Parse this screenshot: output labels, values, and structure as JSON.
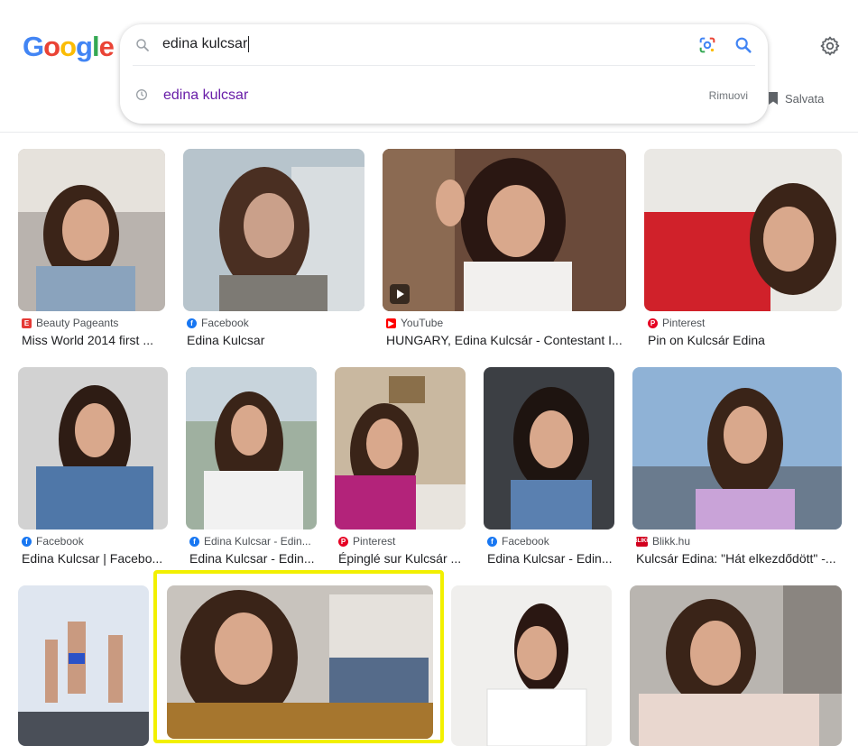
{
  "header": {
    "logo_letters": [
      "G",
      "o",
      "o",
      "g",
      "l",
      "e"
    ],
    "logo_colors": [
      "#4285f4",
      "#ea4335",
      "#fbbc05",
      "#4285f4",
      "#34a853",
      "#ea4335"
    ],
    "settings_icon": "gear-icon"
  },
  "search": {
    "query": "edina kulcsar",
    "suggestion": "edina kulcsar",
    "remove_label": "Rimuovi"
  },
  "saved": {
    "label": "Salvata",
    "icon": "bookmark-icon"
  },
  "results": [
    {
      "source": "Beauty Pageants",
      "title": "Miss World 2014 first ...",
      "icon": "E",
      "fav": "bp"
    },
    {
      "source": "Facebook",
      "title": "Edina Kulcsar",
      "icon": "f",
      "fav": "fb"
    },
    {
      "source": "YouTube",
      "title": "HUNGARY, Edina Kulcsár - Contestant I...",
      "icon": "▶",
      "fav": "yt"
    },
    {
      "source": "Pinterest",
      "title": "Pin on Kulcsár Edina",
      "icon": "P",
      "fav": "pin"
    },
    {
      "source": "Facebook",
      "title": "Edina Kulcsar | Facebo...",
      "icon": "f",
      "fav": "fb"
    },
    {
      "source": "Edina Kulcsar - Edin...",
      "title": "Edina Kulcsar - Edin...",
      "icon": "f",
      "fav": "fb"
    },
    {
      "source": "Pinterest",
      "title": "Épinglé sur Kulcsár ...",
      "icon": "P",
      "fav": "pin"
    },
    {
      "source": "Facebook",
      "title": "Edina Kulcsar - Edin...",
      "icon": "f",
      "fav": "fb"
    },
    {
      "source": "Blikk.hu",
      "title": "Kulcsár Edina: \"Hát elkezdődött\" -...",
      "icon": "BLIKK",
      "fav": "blikk"
    },
    {
      "source": "",
      "title": "",
      "icon": "",
      "fav": ""
    },
    {
      "source": "",
      "title": "",
      "icon": "",
      "fav": ""
    },
    {
      "source": "",
      "title": "",
      "icon": "",
      "fav": ""
    },
    {
      "source": "",
      "title": "",
      "icon": "",
      "fav": ""
    }
  ]
}
